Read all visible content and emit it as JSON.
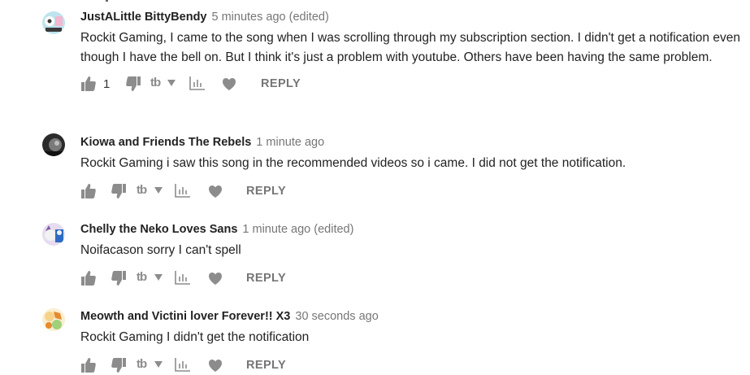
{
  "comments": [
    {
      "author": "JustALittle BittyBendy",
      "time": "5 minutes ago (edited)",
      "text": "Rockit Gaming, I came to the song when I was scrolling through my subscription section. I didn't get a notification even though I have the bell on. But I think it's just a problem with youtube. Others have been having the same problem.",
      "like_count": "1",
      "reply_label": "REPLY",
      "tag_label": "tb",
      "avatar_icon": "cartoon-avatar-icon",
      "avatar_colors": [
        "#bfe3ee",
        "#f3b7cf",
        "#3a3a3a",
        "#ffffff"
      ]
    },
    {
      "author": "Kiowa and Friends The Rebels",
      "time": "1 minute ago",
      "text": "Rockit Gaming i saw this song in the recommended videos so i came. I did not get the notification.",
      "like_count": "",
      "reply_label": "REPLY",
      "tag_label": "tb",
      "avatar_icon": "dark-photo-avatar-icon",
      "avatar_colors": [
        "#2b2b2b",
        "#7a7a7a",
        "#bdbdbd",
        "#111111"
      ]
    },
    {
      "author": "Chelly the Neko Loves Sans",
      "time": "1 minute ago (edited)",
      "text": "Noifacason sorry I can't spell",
      "like_count": "",
      "reply_label": "REPLY",
      "tag_label": "tb",
      "avatar_icon": "neko-avatar-icon",
      "avatar_colors": [
        "#e7dcef",
        "#7d5fa3",
        "#2d6cc4",
        "#f2f2f2"
      ]
    },
    {
      "author": "Meowth and Victini lover Forever!! X3",
      "time": "30 seconds ago",
      "text": "Rockit Gaming I didn't get the notification",
      "like_count": "",
      "reply_label": "REPLY",
      "tag_label": "tb",
      "avatar_icon": "pokemon-avatar-icon",
      "avatar_colors": [
        "#f6d38a",
        "#e58a2e",
        "#9fd07a",
        "#fbeed0"
      ]
    }
  ],
  "colors": {
    "author": "#222222",
    "timestamp": "#767676",
    "icon": "#8c8c8c",
    "reply": "#767676"
  }
}
